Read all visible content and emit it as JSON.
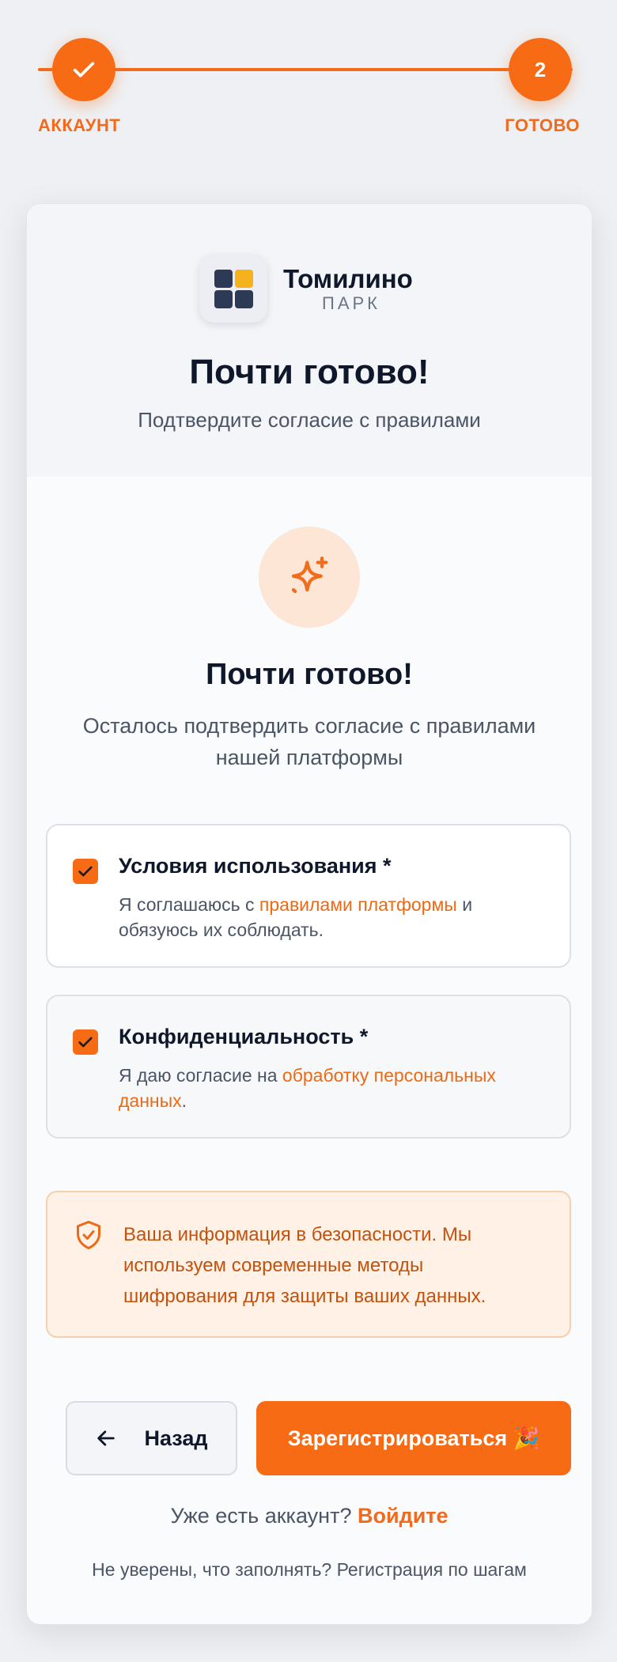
{
  "stepper": {
    "step1_label": "АККАУНТ",
    "step2_number": "2",
    "step2_label": "ГОТОВО"
  },
  "brand": {
    "name": "Томилино",
    "sub": "ПАРК"
  },
  "header": {
    "title": "Почти готово!",
    "subtitle": "Подтвердите согласие с правилами"
  },
  "main": {
    "title": "Почти готово!",
    "subtitle": "Осталось подтвердить согласие с правилами нашей платформы"
  },
  "consents": [
    {
      "title": "Условия использования *",
      "text_before": "Я соглашаюсь с ",
      "link": "правилами платформы",
      "text_after": " и обязуюсь их соблюдать.",
      "checked": true
    },
    {
      "title": "Конфиденциальность *",
      "text_before": "Я даю согласие на ",
      "link": "обработку персональных данных",
      "text_after": ".",
      "checked": true
    }
  ],
  "security_note": "Ваша информация в безопасности. Мы используем современные методы шифрования для защиты ваших данных.",
  "buttons": {
    "back": "Назад",
    "register": "Зарегистрироваться 🎉"
  },
  "footer": {
    "login_prompt": "Уже есть аккаунт?",
    "login_link": "Войдите",
    "stepwise": "Не уверены, что заполнять? Регистрация по шагам"
  },
  "colors": {
    "accent": "#f76b15",
    "brand_dark": "#2d3a55",
    "brand_yellow": "#f5b21d"
  },
  "icons": {
    "step1": "check-icon",
    "hero": "sparkles-icon",
    "security": "shield-check-icon",
    "back": "arrow-left-icon"
  }
}
